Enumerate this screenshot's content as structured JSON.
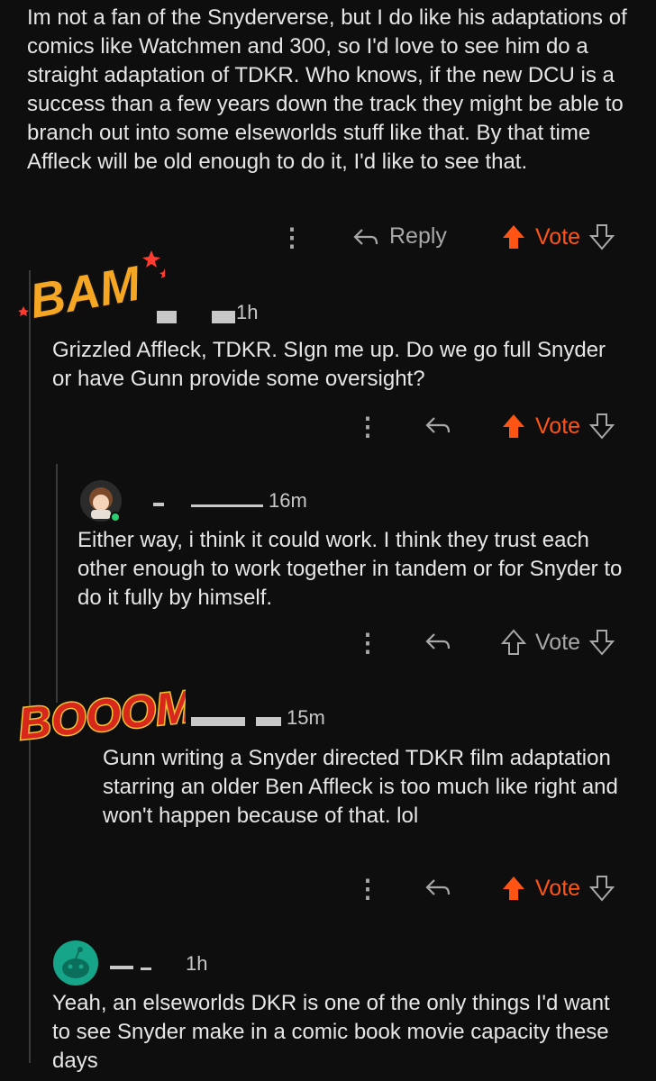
{
  "top_comment": {
    "body": "Im not a fan of the Snyderverse, but I do like his adaptations of comics like Watchmen and 300, so I'd love to see him do a straight adaptation of TDKR. Who knows, if the new DCU is a success than a few years down the track they might be able to branch out into some elseworlds stuff like that. By that time Affleck will be old enough to do it, I'd like to see that.",
    "reply_label": "Reply",
    "vote_label": "Vote"
  },
  "comments": [
    {
      "time": "1h",
      "sticker": "BAM",
      "body": "Grizzled Affleck, TDKR. SIgn me up. Do we go full Snyder or have Gunn provide some oversight?",
      "vote_label": "Vote",
      "upvoted": true
    },
    {
      "time": "16m",
      "body": "Either way, i think it could work. I think they trust each other enough to work together in tandem or for Snyder to do it fully by himself.",
      "vote_label": "Vote",
      "upvoted": false
    },
    {
      "time": "15m",
      "sticker": "BOOOM",
      "body": "Gunn writing a Snyder directed TDKR film adaptation starring an older Ben Affleck is too much like right and won't happen because of that. lol",
      "vote_label": "Vote",
      "upvoted": true
    },
    {
      "time": "1h",
      "body": "Yeah, an elseworlds DKR is one of the only things I'd want to see Snyder make in a comic book movie capacity these days"
    }
  ],
  "colors": {
    "accent": "#ff5414",
    "background": "#0e0e0e",
    "text": "#e6e6e6",
    "muted": "#a8a8a8"
  }
}
